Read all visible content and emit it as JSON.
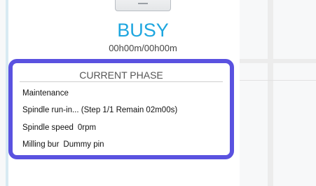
{
  "status": {
    "state": "BUSY",
    "elapsed": "00h00m/00h00m",
    "state_color": "#1ea6df"
  },
  "current_phase": {
    "title": "CURRENT PHASE",
    "phase_name": "Maintenance",
    "step_text": "Spindle run-in... (Step 1/1 Remain 02m00s)",
    "spindle_speed_label": "Spindle speed",
    "spindle_speed_value": "0rpm",
    "milling_bur_label": "Milling bur",
    "milling_bur_value": "Dummy pin",
    "highlight_color": "#5a52e0"
  },
  "icons": {
    "machine": "milling-machine-icon"
  }
}
